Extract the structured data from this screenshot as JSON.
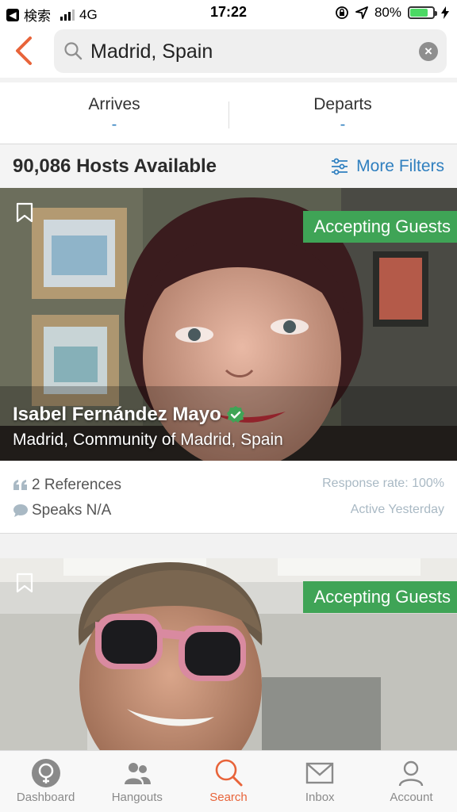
{
  "status_bar": {
    "carrier_back": "検索",
    "network": "4G",
    "time": "17:22",
    "battery": "80%",
    "battery_level": 0.8
  },
  "search": {
    "value": "Madrid, Spain"
  },
  "dates": {
    "arrives_label": "Arrives",
    "arrives_value": "-",
    "departs_label": "Departs",
    "departs_value": "-"
  },
  "results": {
    "count_label": "90,086 Hosts Available",
    "filters_label": "More Filters"
  },
  "hosts": [
    {
      "status": "Accepting Guests",
      "name": "Isabel Fernández Mayo",
      "location": "Madrid, Community of Madrid, Spain",
      "references": "2 References",
      "speaks": "Speaks N/A",
      "response_rate": "Response rate: 100%",
      "activity": "Active Yesterday"
    },
    {
      "status": "Accepting Guests"
    }
  ],
  "tabs": [
    {
      "label": "Dashboard",
      "icon": "dashboard-icon"
    },
    {
      "label": "Hangouts",
      "icon": "people-icon"
    },
    {
      "label": "Search",
      "icon": "search-icon"
    },
    {
      "label": "Inbox",
      "icon": "mail-icon"
    },
    {
      "label": "Account",
      "icon": "person-icon"
    }
  ],
  "colors": {
    "accent": "#e8643a",
    "link": "#2f7fbf",
    "accepting": "#3fa456"
  }
}
